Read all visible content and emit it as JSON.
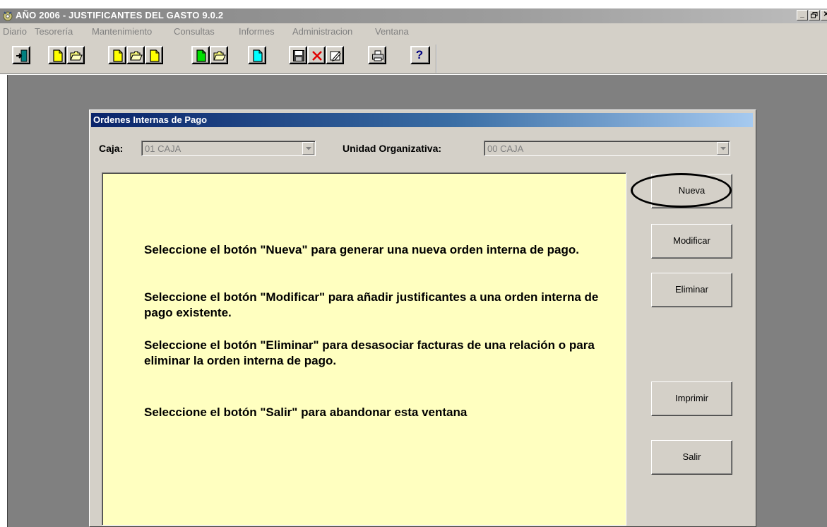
{
  "window": {
    "title": "AÑO 2006 - JUSTIFICANTES DEL GASTO 9.0.2",
    "controls": [
      "_",
      "🗗",
      "✕"
    ]
  },
  "menu": {
    "items": [
      "Diario",
      "Tesorería",
      "Mantenimiento",
      "Consultas",
      "Informes",
      "Administracion",
      "Ventana"
    ]
  },
  "toolbar": {
    "help_label": "?"
  },
  "child_window": {
    "title": "Ordenes Internas de Pago",
    "caja_label": "Caja:",
    "caja_value": "01  CAJA",
    "unidad_label": "Unidad Organizativa:",
    "unidad_value": "00  CAJA",
    "instructions": [
      "Seleccione el botón \"Nueva\" para generar una nueva orden interna de pago.",
      "Seleccione el botón \"Modificar\" para añadir justificantes a una orden interna de pago existente.",
      "Seleccione el botón \"Eliminar\" para desasociar facturas de una relación o para eliminar la orden interna de pago.",
      "Seleccione el botón \"Salir\" para abandonar esta ventana"
    ],
    "buttons": {
      "nueva": "Nueva",
      "modificar": "Modificar",
      "eliminar": "Eliminar",
      "imprimir": "Imprimir",
      "salir": "Salir"
    }
  },
  "colors": {
    "info_panel_bg": "#ffffc0",
    "child_title_start": "#0a246a",
    "child_title_end": "#a6caf0"
  }
}
